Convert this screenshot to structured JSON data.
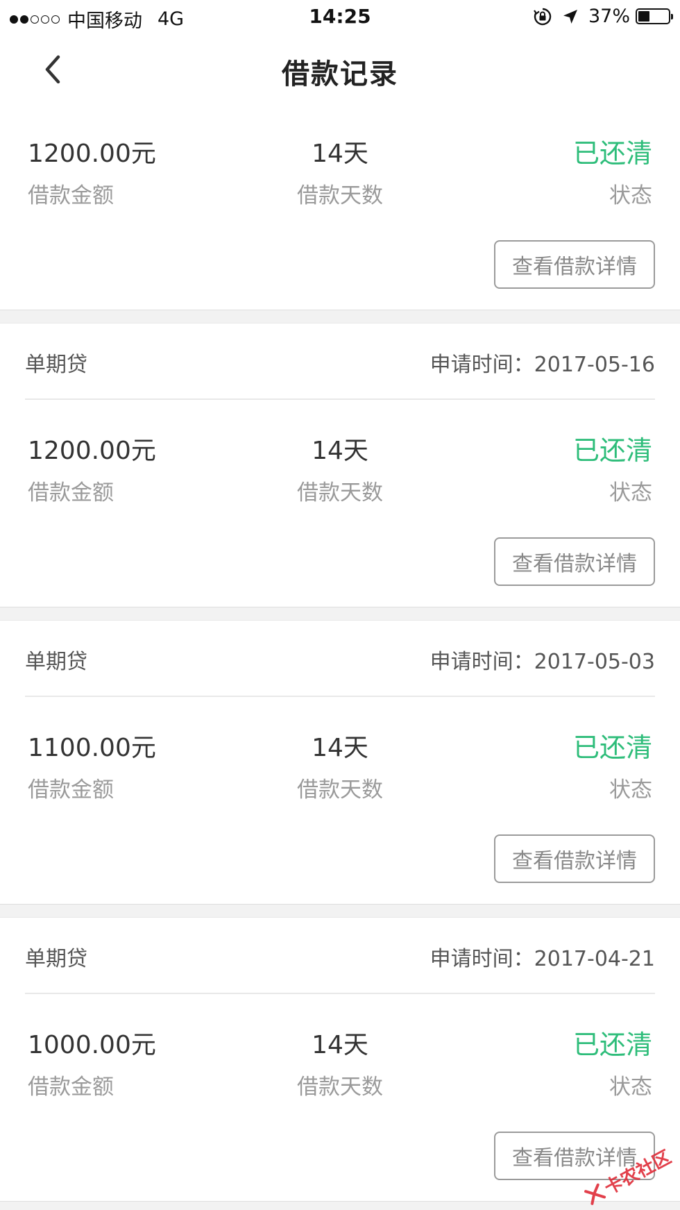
{
  "status_bar": {
    "signal_dots": [
      true,
      true,
      false,
      false,
      false
    ],
    "carrier": "中国移动",
    "network": "4G",
    "time": "14:25",
    "icons": [
      "rotation-lock-icon",
      "location-arrow-icon"
    ],
    "battery_text": "37%",
    "battery_level": 0.37
  },
  "nav": {
    "back_icon": "chevron-left-icon",
    "title": "借款记录"
  },
  "colors": {
    "status_green": "#2ebd7a",
    "label_gray": "#9a9a9a",
    "divider": "#e8e8e8",
    "gap_bg": "#f2f2f2"
  },
  "records": [
    {
      "loan_type": "",
      "apply_time": "",
      "amount": "1200.00元",
      "amount_label": "借款金额",
      "days": "14天",
      "days_label": "借款天数",
      "status": "已还清",
      "status_label": "状态",
      "detail_button": "查看借款详情"
    },
    {
      "loan_type": "单期贷",
      "apply_time": "申请时间：2017-05-16",
      "amount": "1200.00元",
      "amount_label": "借款金额",
      "days": "14天",
      "days_label": "借款天数",
      "status": "已还清",
      "status_label": "状态",
      "detail_button": "查看借款详情"
    },
    {
      "loan_type": "单期贷",
      "apply_time": "申请时间：2017-05-03",
      "amount": "1100.00元",
      "amount_label": "借款金额",
      "days": "14天",
      "days_label": "借款天数",
      "status": "已还清",
      "status_label": "状态",
      "detail_button": "查看借款详情"
    },
    {
      "loan_type": "单期贷",
      "apply_time": "申请时间：2017-04-21",
      "amount": "1000.00元",
      "amount_label": "借款金额",
      "days": "14天",
      "days_label": "借款天数",
      "status": "已还清",
      "status_label": "状态",
      "detail_button": "查看借款详情"
    }
  ],
  "watermark": {
    "text": "卡农社区",
    "icon": "kanong-logo-icon"
  }
}
